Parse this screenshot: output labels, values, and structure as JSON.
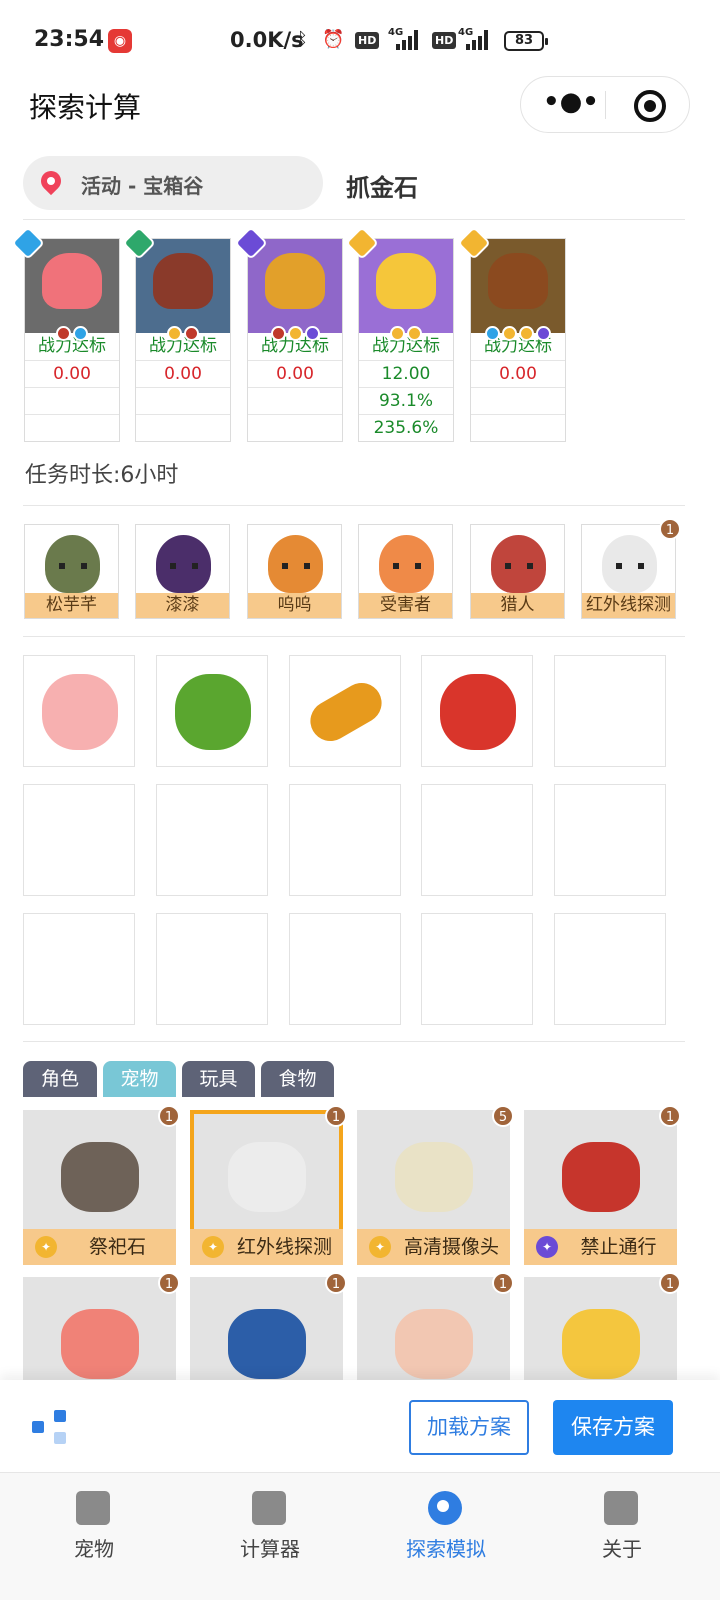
{
  "status_bar": {
    "time": "23:54",
    "speed": "0.0K/s",
    "hd1": "HD",
    "net1": "4G",
    "hd2": "HD",
    "net2": "4G",
    "battery": "83"
  },
  "header": {
    "title": "探索计算"
  },
  "location": {
    "text": "活动 - 宝箱谷",
    "target": "抓金石"
  },
  "targets": [
    {
      "status": "战力达标",
      "values": [
        "0.00",
        "",
        ""
      ],
      "rank_color": "#2fa3e6",
      "art_color": "#f0727a",
      "bg": "#6b6b6b",
      "elements": [
        "#c0392b",
        "#2fa3e6"
      ]
    },
    {
      "status": "战力达标",
      "values": [
        "0.00",
        "",
        ""
      ],
      "rank_color": "#2ea86b",
      "art_color": "#8a3a2a",
      "bg": "#4d6d8e",
      "elements": [
        "#f2b531",
        "#c0392b"
      ]
    },
    {
      "status": "战力达标",
      "values": [
        "0.00",
        "",
        ""
      ],
      "rank_color": "#6b4bd6",
      "art_color": "#e2a02a",
      "bg": "#8f67c9",
      "elements": [
        "#c0392b",
        "#f2b531",
        "#6b4bd6"
      ]
    },
    {
      "status": "战力达标",
      "values": [
        "12.00",
        "93.1%",
        "235.6%"
      ],
      "rank_color": "#f2b531",
      "art_color": "#f5c63a",
      "bg": "#9a6fd6",
      "elements": [
        "#f2b531",
        "#f2b531"
      ]
    },
    {
      "status": "战力达标",
      "values": [
        "0.00",
        "",
        ""
      ],
      "rank_color": "#f2b531",
      "art_color": "#8b4a1f",
      "bg": "#7a5a2c",
      "elements": [
        "#2fa3e6",
        "#f2b531",
        "#f2b531",
        "#6b4bd6"
      ]
    }
  ],
  "duration": "任务时长:6小时",
  "team": {
    "members": [
      {
        "name": "松芋芊",
        "color": "#6a7a4c"
      },
      {
        "name": "漆漆",
        "color": "#4b2e6a"
      },
      {
        "name": "呜呜",
        "color": "#e58a34"
      },
      {
        "name": "受害者",
        "color": "#ef8a48"
      },
      {
        "name": "猎人",
        "color": "#c0453c"
      },
      {
        "name": "红外线探测",
        "color": "#e9e9e9"
      }
    ],
    "last_count": "1"
  },
  "items": [
    {
      "color": "#f7b0b0",
      "shape": "mushroom"
    },
    {
      "color": "#5aa62f",
      "shape": "flower"
    },
    {
      "color": "#e79a1d",
      "shape": "flashlight"
    },
    {
      "color": "#d9352b",
      "shape": "bucket"
    }
  ],
  "tabs": [
    {
      "label": "角色",
      "color": "#5e6377"
    },
    {
      "label": "宠物",
      "color": "#79c7d6"
    },
    {
      "label": "玩具",
      "color": "#5e6377"
    },
    {
      "label": "食物",
      "color": "#5e6377"
    }
  ],
  "inventory": [
    {
      "name": "祭祀石",
      "count": "1",
      "rank_color": "#f2b531",
      "art_color": "#6e6258",
      "selected": false
    },
    {
      "name": "红外线探测",
      "count": "1",
      "rank_color": "#f2b531",
      "art_color": "#ececec",
      "selected": true
    },
    {
      "name": "高清摄像头",
      "count": "5",
      "rank_color": "#f2b531",
      "art_color": "#e9e2c6",
      "selected": false
    },
    {
      "name": "禁止通行",
      "count": "1",
      "rank_color": "#6b4bd6",
      "art_color": "#c6352c",
      "selected": false
    },
    {
      "name": "",
      "count": "1",
      "rank_color": "",
      "art_color": "#f08277",
      "selected": false
    },
    {
      "name": "",
      "count": "1",
      "rank_color": "",
      "art_color": "#2c5ea8",
      "selected": false
    },
    {
      "name": "",
      "count": "1",
      "rank_color": "",
      "art_color": "#f2c7b2",
      "selected": false
    },
    {
      "name": "",
      "count": "1",
      "rank_color": "",
      "art_color": "#f4c63e",
      "selected": false
    }
  ],
  "actions": {
    "load": "加载方案",
    "save": "保存方案"
  },
  "tabbar": [
    {
      "label": "宠物",
      "active": false
    },
    {
      "label": "计算器",
      "active": false
    },
    {
      "label": "探索模拟",
      "active": true
    },
    {
      "label": "关于",
      "active": false
    }
  ],
  "colors": {
    "accent": "#1e86f0",
    "label_bg": "#f7c98b",
    "selected_border": "#f4a51c",
    "count_badge": "#a0643a",
    "green_text": "#1a8a2a",
    "red_text": "#d7262b"
  }
}
